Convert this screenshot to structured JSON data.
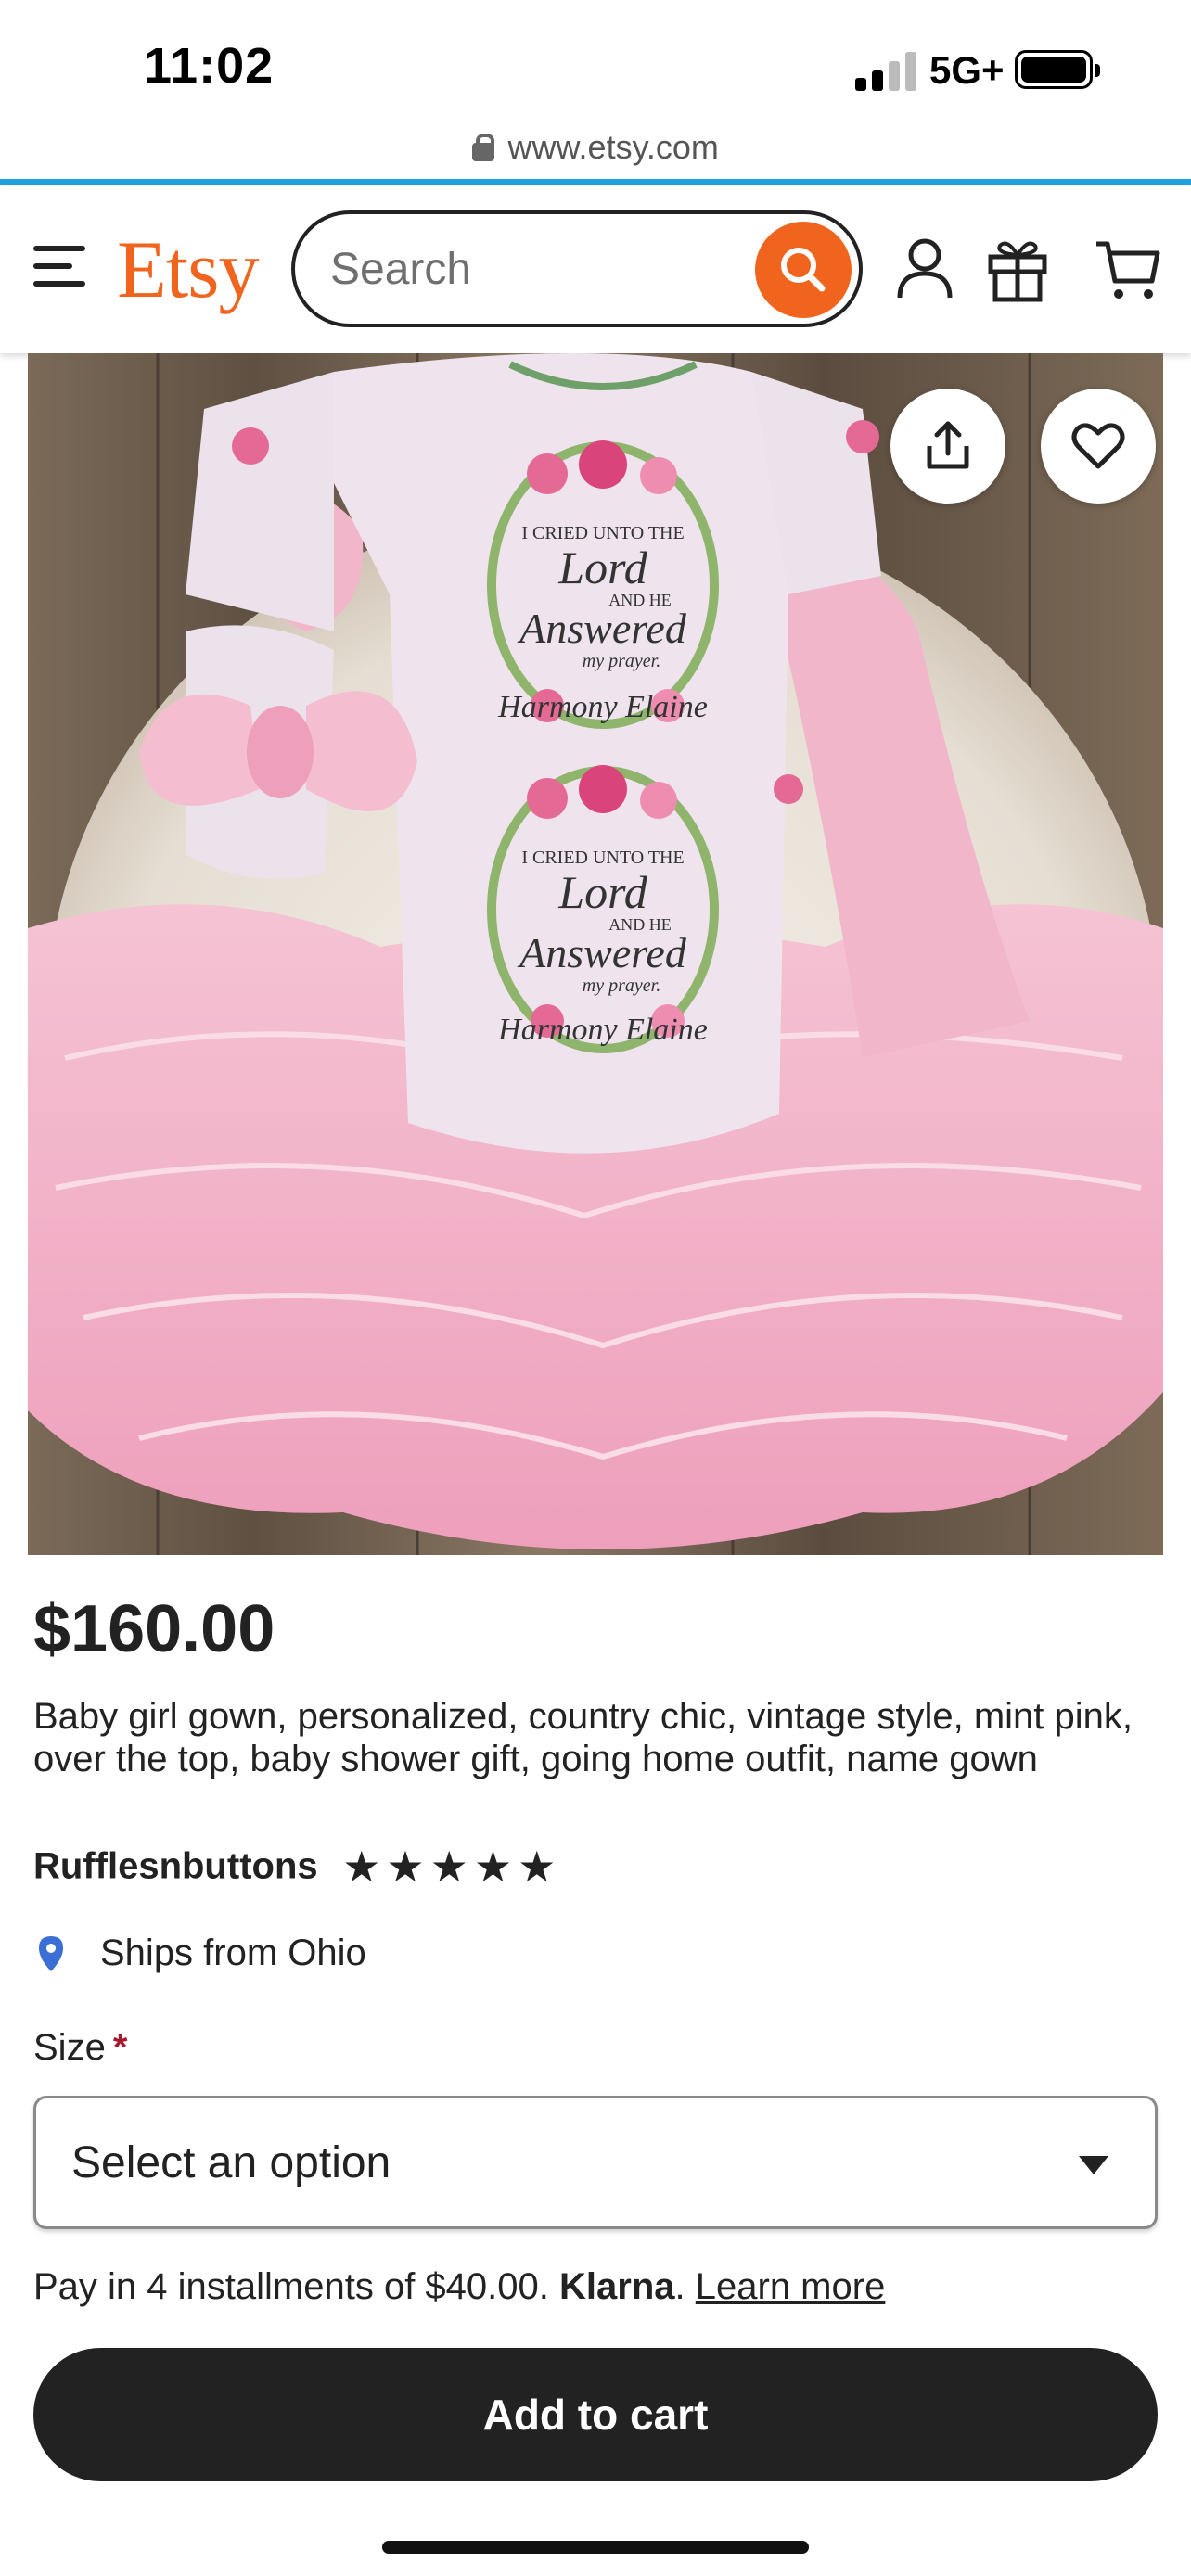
{
  "status_bar": {
    "time": "11:02",
    "network": "5G+",
    "url": "www.etsy.com"
  },
  "header": {
    "menu_icon": "hamburger-menu-icon",
    "logo": "Etsy",
    "search_placeholder": "Search",
    "search_icon": "magnifier-icon",
    "icons": [
      "user-icon",
      "gift-icon",
      "cart-icon"
    ]
  },
  "product": {
    "image_alt": "Pink baby girl gown with floral print and ruffles",
    "image_text": {
      "line1": "I CRIED UNTO THE",
      "line2": "Lord",
      "line3": "AND HE",
      "line4": "Answered",
      "line5": "my prayer.",
      "name": "Harmony Elaine"
    },
    "price": "$160.00",
    "title": "Baby girl gown, personalized, country chic, vintage style, mint pink, over the top, baby shower gift, going home outfit, name gown",
    "shop_name": "Rufflesnbuttons",
    "rating_stars": 5,
    "ships_from": "Ships from Ohio"
  },
  "options": {
    "size_label": "Size",
    "required_mark": "*",
    "select_placeholder": "Select an option"
  },
  "payment": {
    "installment_text": "Pay in 4 installments of $40.00.",
    "provider": "Klarna",
    "period": ".",
    "learn_more": "Learn more"
  },
  "actions": {
    "add_to_cart": "Add to cart"
  },
  "colors": {
    "brand": "#f1641e",
    "accent_line": "#1ea1dd",
    "button_dark": "#222222",
    "required": "#a61a2e",
    "pin": "#3b6fd4"
  }
}
